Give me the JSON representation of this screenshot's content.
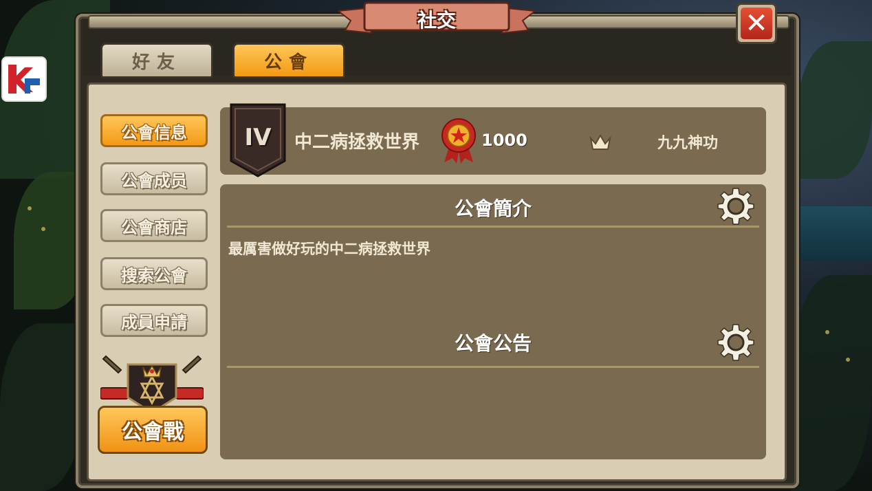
{
  "window": {
    "title": "社交",
    "close_icon": "close-icon"
  },
  "tabs": [
    {
      "label": "好友",
      "active": false
    },
    {
      "label": "公會",
      "active": true
    }
  ],
  "sidebar": {
    "items": [
      {
        "label": "公會信息",
        "active": true
      },
      {
        "label": "公會成员",
        "active": false
      },
      {
        "label": "公會商店",
        "active": false
      },
      {
        "label": "搜索公會",
        "active": false
      },
      {
        "label": "成員申請",
        "active": false
      }
    ],
    "war_button": "公會戰"
  },
  "guild": {
    "rank": "IV",
    "name": "中二病拯救世界",
    "score": "1000",
    "leader": "九九神功"
  },
  "intro": {
    "title": "公會簡介",
    "text": "最厲害做好玩的中二病拯救世界"
  },
  "notice": {
    "title": "公會公告",
    "text": ""
  },
  "colors": {
    "accent_orange": "#f29a16",
    "panel_brown": "#7a6a50",
    "close_red": "#c8301e"
  }
}
